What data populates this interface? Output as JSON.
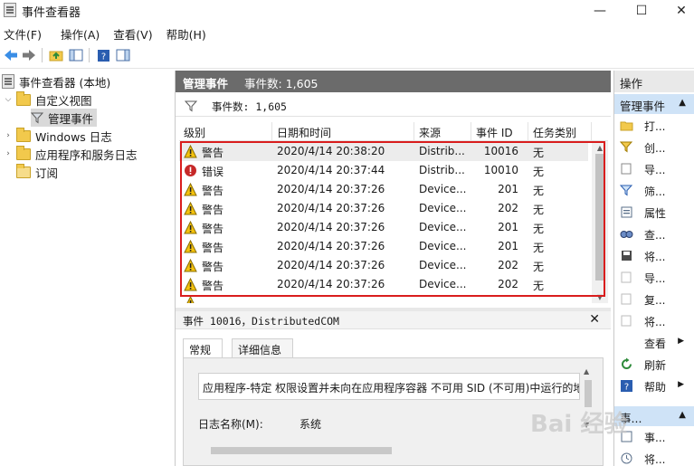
{
  "window": {
    "title": "事件查看器",
    "minimize": "—",
    "maximize": "☐",
    "close": "✕"
  },
  "menu": [
    "文件(F)",
    "操作(A)",
    "查看(V)",
    "帮助(H)"
  ],
  "tree": [
    {
      "label": "事件查看器 (本地)"
    },
    {
      "label": "自定义视图"
    },
    {
      "label": "管理事件"
    },
    {
      "label": "Windows 日志"
    },
    {
      "label": "应用程序和服务日志"
    },
    {
      "label": "订阅"
    }
  ],
  "center": {
    "header_title": "管理事件",
    "header_count": "事件数: 1,605",
    "filter_text": "事件数: 1,605",
    "columns": [
      "级别",
      "日期和时间",
      "来源",
      "事件 ID",
      "任务类别"
    ],
    "rows": [
      {
        "level": "警告",
        "icon": "warning-icon",
        "datetime": "2020/4/14 20:38:20",
        "source": "Distrib...",
        "id": "10016",
        "task": "无"
      },
      {
        "level": "错误",
        "icon": "error-icon",
        "datetime": "2020/4/14 20:37:44",
        "source": "Distrib...",
        "id": "10010",
        "task": "无"
      },
      {
        "level": "警告",
        "icon": "warning-icon",
        "datetime": "2020/4/14 20:37:26",
        "source": "Device...",
        "id": "201",
        "task": "无"
      },
      {
        "level": "警告",
        "icon": "warning-icon",
        "datetime": "2020/4/14 20:37:26",
        "source": "Device...",
        "id": "202",
        "task": "无"
      },
      {
        "level": "警告",
        "icon": "warning-icon",
        "datetime": "2020/4/14 20:37:26",
        "source": "Device...",
        "id": "201",
        "task": "无"
      },
      {
        "level": "警告",
        "icon": "warning-icon",
        "datetime": "2020/4/14 20:37:26",
        "source": "Device...",
        "id": "201",
        "task": "无"
      },
      {
        "level": "警告",
        "icon": "warning-icon",
        "datetime": "2020/4/14 20:37:26",
        "source": "Device...",
        "id": "202",
        "task": "无"
      },
      {
        "level": "警告",
        "icon": "warning-icon",
        "datetime": "2020/4/14 20:37:26",
        "source": "Device...",
        "id": "202",
        "task": "无"
      }
    ]
  },
  "detail": {
    "title": "事件 10016，DistributedCOM",
    "close": "✕",
    "tabs": [
      "常规",
      "详细信息"
    ],
    "description": "应用程序-特定 权限设置并未向在应用程序容器 不可用 SID (不可用)中运行的地",
    "log_name_label": "日志名称(M):",
    "log_name_value": "系统"
  },
  "actions": {
    "title": "操作",
    "section1": "管理事件",
    "items1": [
      {
        "label": "打...",
        "icon": "open-folder-icon"
      },
      {
        "label": "创...",
        "icon": "create-filter-icon"
      },
      {
        "label": "导...",
        "icon": "import-icon"
      },
      {
        "label": "筛...",
        "icon": "filter-icon"
      },
      {
        "label": "属性",
        "icon": "properties-icon"
      },
      {
        "label": "查...",
        "icon": "find-icon"
      },
      {
        "label": "将...",
        "icon": "save-icon"
      },
      {
        "label": "导...",
        "icon": "export-icon"
      },
      {
        "label": "复...",
        "icon": "copy-icon"
      },
      {
        "label": "将...",
        "icon": "attach-icon"
      },
      {
        "label": "查看",
        "icon": "view-icon",
        "submenu": true
      },
      {
        "label": "刷新",
        "icon": "refresh-icon"
      },
      {
        "label": "帮助",
        "icon": "help-icon",
        "submenu": true
      }
    ],
    "section2": "事...",
    "items2": [
      {
        "label": "事...",
        "icon": "event-properties-icon"
      },
      {
        "label": "将...",
        "icon": "attach-task-icon"
      }
    ]
  },
  "watermark": "Bai 经验",
  "colors": {
    "header_bg": "#6b6b6b",
    "selection": "#cfe3f7",
    "highlight_box": "#d91d1d",
    "warning": "#f4c20d",
    "error": "#c62828"
  }
}
